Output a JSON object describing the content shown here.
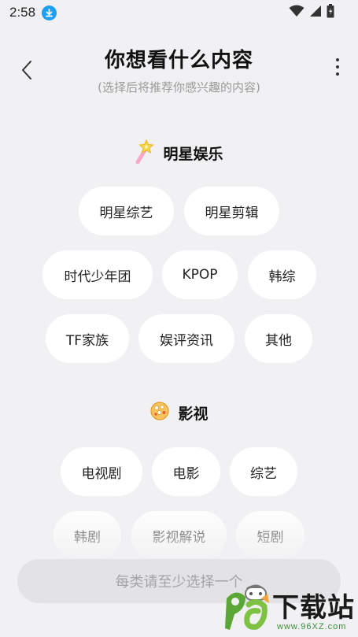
{
  "status_bar": {
    "time": "2:58"
  },
  "header": {
    "title": "你想看什么内容",
    "subtitle": "(选择后将推荐你感兴趣的内容)"
  },
  "sections": [
    {
      "title": "明星娱乐",
      "icon": "magic-wand-icon",
      "chips": [
        "明星综艺",
        "明星剪辑",
        "时代少年团",
        "KPOP",
        "韩综",
        "TF家族",
        "娱评资讯",
        "其他"
      ]
    },
    {
      "title": "影视",
      "icon": "popcorn-icon",
      "chips": [
        "电视剧",
        "电影",
        "综艺",
        "韩剧",
        "影视解说",
        "短剧"
      ]
    }
  ],
  "bottom_button": {
    "label": "每类请至少选择一个"
  },
  "watermark": {
    "logo_text": "下载站",
    "url": "www.96XZ.com"
  },
  "colors": {
    "background": "#f1f1f3",
    "chip": "#ffffff",
    "accent_blue": "#1e9ef5",
    "disabled_button": "#e3e3e6"
  }
}
